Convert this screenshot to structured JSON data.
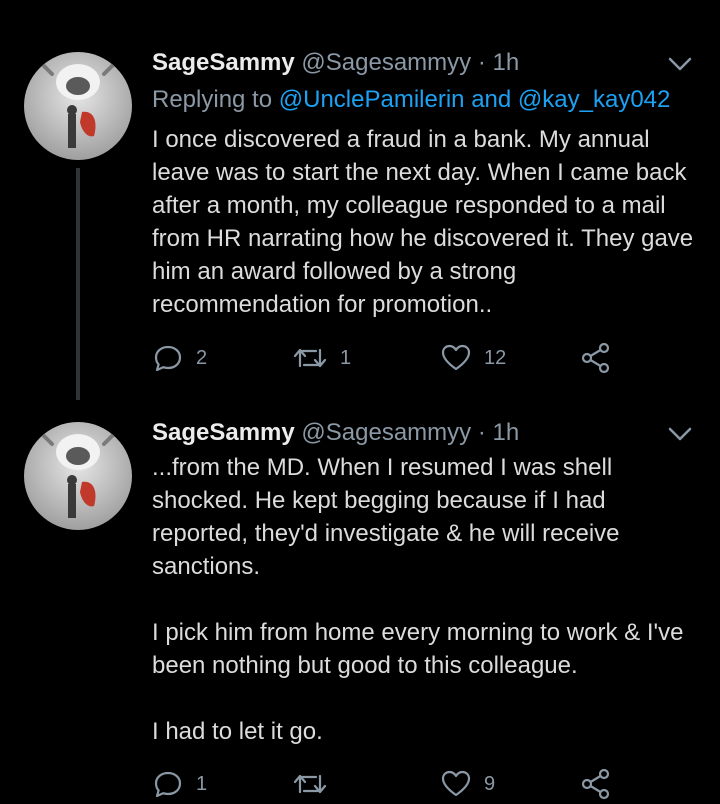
{
  "tweets": [
    {
      "name": "SageSammy",
      "handle": "@Sagesammyy",
      "sep": "·",
      "time": "1h",
      "reply_prefix": "Replying to",
      "reply_to_1": "@UnclePamilerin",
      "reply_and": "and",
      "reply_to_2": "@kay_kay042",
      "paragraphs": [
        "I once discovered a fraud in a bank. My annual leave was to start the next day. When I came back after a month, my colleague responded to a mail from HR narrating how he discovered it. They gave him an award followed by a strong recommendation for promotion.."
      ],
      "replies": "2",
      "retweets": "1",
      "likes": "12"
    },
    {
      "name": "SageSammy",
      "handle": "@Sagesammyy",
      "sep": "·",
      "time": "1h",
      "paragraphs": [
        "...from the MD. When I resumed I was shell shocked. He kept begging because if I had reported, they'd investigate & he will receive sanctions.",
        "I pick him from home every morning to work & I've been nothing but good to this colleague.",
        "I had to let it go."
      ],
      "replies": "1",
      "retweets": "",
      "likes": "9"
    }
  ],
  "icons": {
    "chevron": "chevron-down-icon",
    "reply": "reply-icon",
    "retweet": "retweet-icon",
    "like": "heart-icon",
    "share": "share-icon"
  },
  "colors": {
    "background": "#000000",
    "text": "#dcdcdc",
    "muted": "#8b98a5",
    "mention": "#1da1f2",
    "avatar_accent": "#c0392b"
  }
}
